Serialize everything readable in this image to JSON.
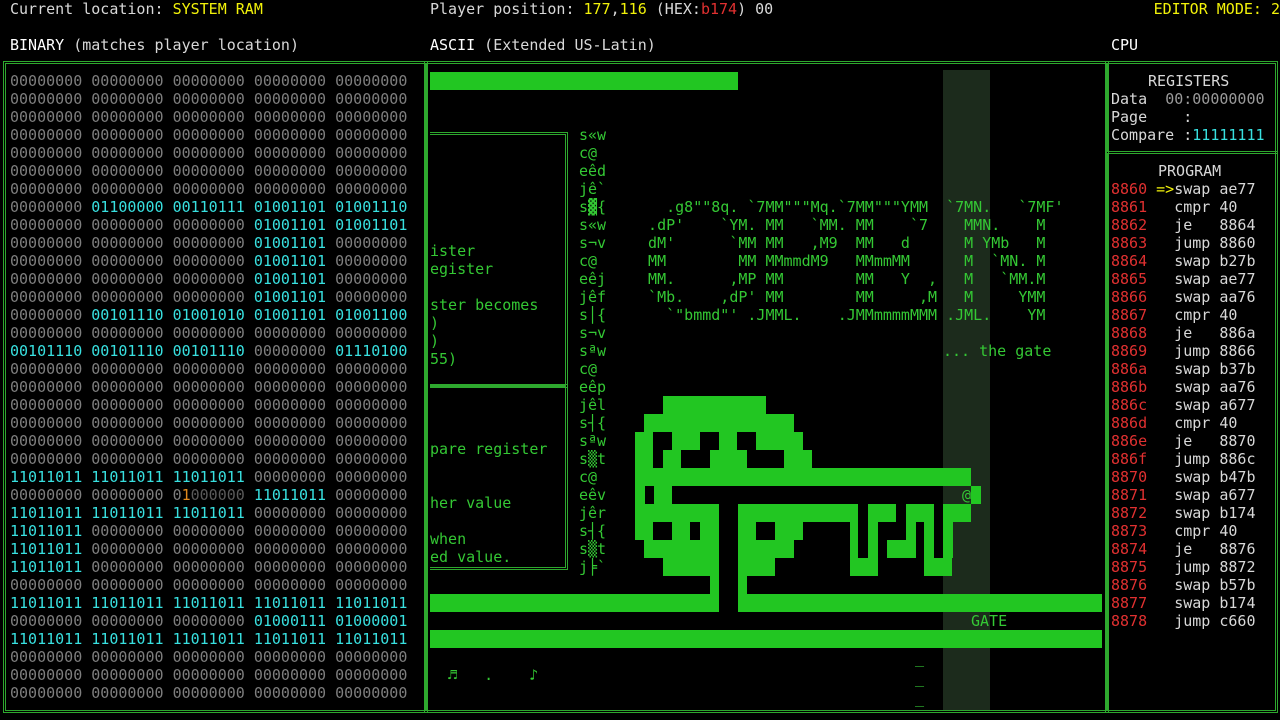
{
  "header": {
    "location_label": "Current location: ",
    "location_value": "SYSTEM RAM",
    "position_label": "Player position: ",
    "pos_x": "177",
    "pos_sep": ",",
    "pos_y": "116",
    "hex_open": " (HEX:",
    "hex_value": "b174",
    "hex_close": ") 00",
    "editor_label": "EDITOR MODE: 2"
  },
  "panels": {
    "binary_title": "BINARY",
    "binary_sub": " (matches player location)",
    "ascii_title": "ASCII",
    "ascii_sub": " (Extended US-Latin)",
    "cpu_title": "CPU"
  },
  "binary_rows": [
    [
      "00000000",
      "00000000",
      "00000000",
      "00000000",
      "00000000"
    ],
    [
      "00000000",
      "00000000",
      "00000000",
      "00000000",
      "00000000"
    ],
    [
      "00000000",
      "00000000",
      "00000000",
      "00000000",
      "00000000"
    ],
    [
      "00000000",
      "00000000",
      "00000000",
      "00000000",
      "00000000"
    ],
    [
      "00000000",
      "00000000",
      "00000000",
      "00000000",
      "00000000"
    ],
    [
      "00000000",
      "00000000",
      "00000000",
      "00000000",
      "00000000"
    ],
    [
      "00000000",
      "00000000",
      "00000000",
      "00000000",
      "00000000"
    ],
    [
      "00000000",
      "01100000",
      "00110111",
      "01001101",
      "01001110"
    ],
    [
      "00000000",
      "00000000",
      "00000000",
      "01001101",
      "01001101"
    ],
    [
      "00000000",
      "00000000",
      "00000000",
      "01001101",
      "00000000"
    ],
    [
      "00000000",
      "00000000",
      "00000000",
      "01001101",
      "00000000"
    ],
    [
      "00000000",
      "00000000",
      "00000000",
      "01001101",
      "00000000"
    ],
    [
      "00000000",
      "00000000",
      "00000000",
      "01001101",
      "00000000"
    ],
    [
      "00000000",
      "00101110",
      "01001010",
      "01001101",
      "01001100"
    ],
    [
      "00000000",
      "00000000",
      "00000000",
      "00000000",
      "00000000"
    ],
    [
      "00101110",
      "00101110",
      "00101110",
      "00000000",
      "01110100"
    ],
    [
      "00000000",
      "00000000",
      "00000000",
      "00000000",
      "00000000"
    ],
    [
      "00000000",
      "00000000",
      "00000000",
      "00000000",
      "00000000"
    ],
    [
      "00000000",
      "00000000",
      "00000000",
      "00000000",
      "00000000"
    ],
    [
      "00000000",
      "00000000",
      "00000000",
      "00000000",
      "00000000"
    ],
    [
      "00000000",
      "00000000",
      "00000000",
      "00000000",
      "00000000"
    ],
    [
      "00000000",
      "00000000",
      "00000000",
      "00000000",
      "00000000"
    ],
    [
      "11011011",
      "11011011",
      "11011011",
      "00000000",
      "00000000"
    ],
    [
      "00000000",
      "00000000",
      "01000000",
      "11011011",
      "00000000"
    ],
    [
      "11011011",
      "11011011",
      "11011011",
      "00000000",
      "00000000"
    ],
    [
      "11011011",
      "00000000",
      "00000000",
      "00000000",
      "00000000"
    ],
    [
      "11011011",
      "00000000",
      "00000000",
      "00000000",
      "00000000"
    ],
    [
      "11011011",
      "00000000",
      "00000000",
      "00000000",
      "00000000"
    ],
    [
      "00000000",
      "00000000",
      "00000000",
      "00000000",
      "00000000"
    ],
    [
      "11011011",
      "11011011",
      "11011011",
      "11011011",
      "11011011"
    ],
    [
      "00000000",
      "00000000",
      "00000000",
      "01000111",
      "01000001"
    ],
    [
      "11011011",
      "11011011",
      "11011011",
      "11011011",
      "11011011"
    ],
    [
      "00000000",
      "00000000",
      "00000000",
      "00000000",
      "00000000"
    ],
    [
      "00000000",
      "00000000",
      "00000000",
      "00000000",
      "00000000"
    ],
    [
      "00000000",
      "00000000",
      "00000000",
      "00000000",
      "00000000"
    ]
  ],
  "ascii": {
    "left_column": [
      "s«w",
      "c@",
      "eêd",
      "jê`",
      "s▓{",
      "s«w",
      "s¬v",
      "c@",
      "eêj",
      "jêf",
      "s│{",
      "s¬v",
      "sªw",
      "c@",
      "eêp",
      "jêl",
      "s┤{",
      "sªw",
      "s▒t",
      "c@",
      "eêv",
      "jêr",
      "s┤{",
      "s▒t",
      "j╞`"
    ],
    "box1_lines": [
      "",
      "",
      "",
      "",
      "",
      "",
      "ister",
      "egister",
      "",
      "ster becomes",
      ")",
      ")",
      "55)"
    ],
    "box2_lines": [
      "",
      "",
      "",
      "pare register",
      "",
      "",
      "her value",
      "",
      "when",
      "ed value."
    ],
    "banner": [
      "    .g8\"\"8q. `7MM\"\"\"Mq.`7MM\"\"\"YMM  `7MN.   `7MF'",
      "  .dP'    `YM. MM   `MM. MM    `7    MMN.    M",
      "  dM'      `MM MM   ,M9  MM   d      M YMb   M",
      "  MM        MM MMmmdM9   MMmmMM      M  `MN. M",
      "  MM.      ,MP MM        MM   Y  ,   M   `MM.M",
      "  `Mb.    ,dP' MM        MM     ,M   M     YMM",
      "    `\"bmmd\"' .JMML.    .JMMmmmmMMM .JML.    YM"
    ],
    "gate_hint": "... the gate",
    "gate_label": "GATE",
    "player_glyph": "@",
    "notes": "♬   .    ♪",
    "dashes": [
      "_",
      "_",
      "_"
    ]
  },
  "cpu": {
    "registers_title": "REGISTERS",
    "data_label": "Data  ",
    "data_value": "00:00000000",
    "page_label": "Page    :",
    "compare_label": "Compare :",
    "compare_value": "11111111",
    "program_title": "PROGRAM",
    "program": [
      {
        "addr": "8860",
        "arrow": "=>",
        "instr": "swap ae77"
      },
      {
        "addr": "8861",
        "arrow": "  ",
        "instr": "cmpr 40"
      },
      {
        "addr": "8862",
        "arrow": "  ",
        "instr": "je   8864"
      },
      {
        "addr": "8863",
        "arrow": "  ",
        "instr": "jump 8860"
      },
      {
        "addr": "8864",
        "arrow": "  ",
        "instr": "swap b27b"
      },
      {
        "addr": "8865",
        "arrow": "  ",
        "instr": "swap ae77"
      },
      {
        "addr": "8866",
        "arrow": "  ",
        "instr": "swap aa76"
      },
      {
        "addr": "8867",
        "arrow": "  ",
        "instr": "cmpr 40"
      },
      {
        "addr": "8868",
        "arrow": "  ",
        "instr": "je   886a"
      },
      {
        "addr": "8869",
        "arrow": "  ",
        "instr": "jump 8866"
      },
      {
        "addr": "886a",
        "arrow": "  ",
        "instr": "swap b37b"
      },
      {
        "addr": "886b",
        "arrow": "  ",
        "instr": "swap aa76"
      },
      {
        "addr": "886c",
        "arrow": "  ",
        "instr": "swap a677"
      },
      {
        "addr": "886d",
        "arrow": "  ",
        "instr": "cmpr 40"
      },
      {
        "addr": "886e",
        "arrow": "  ",
        "instr": "je   8870"
      },
      {
        "addr": "886f",
        "arrow": "  ",
        "instr": "jump 886c"
      },
      {
        "addr": "8870",
        "arrow": "  ",
        "instr": "swap b47b"
      },
      {
        "addr": "8871",
        "arrow": "  ",
        "instr": "swap a677"
      },
      {
        "addr": "8872",
        "arrow": "  ",
        "instr": "swap b174"
      },
      {
        "addr": "8873",
        "arrow": "  ",
        "instr": "cmpr 40"
      },
      {
        "addr": "8874",
        "arrow": "  ",
        "instr": "je   8876"
      },
      {
        "addr": "8875",
        "arrow": "  ",
        "instr": "jump 8872"
      },
      {
        "addr": "8876",
        "arrow": "  ",
        "instr": "swap b57b"
      },
      {
        "addr": "8877",
        "arrow": "  ",
        "instr": "swap b174"
      },
      {
        "addr": "8878",
        "arrow": "  ",
        "instr": "jump c660"
      }
    ]
  },
  "colors": {
    "accent_green": "#22c622",
    "highlight_cyan": "#38e0e0",
    "address_red": "#e03030",
    "label_yellow": "#f2f20a"
  }
}
